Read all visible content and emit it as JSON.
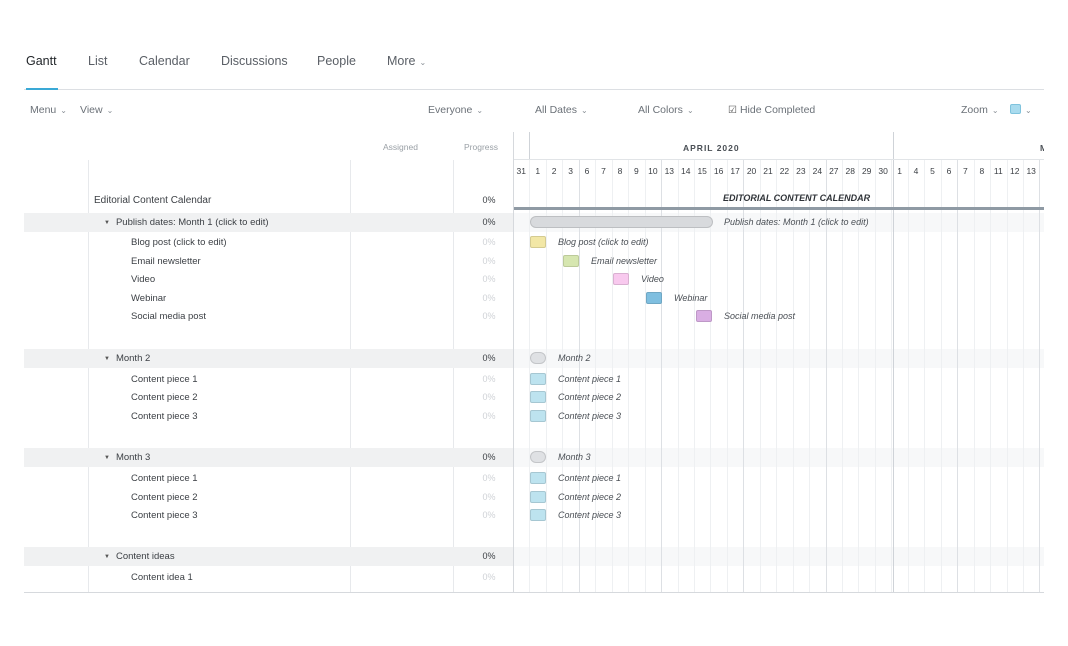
{
  "tabs": [
    {
      "label": "Gantt"
    },
    {
      "label": "List"
    },
    {
      "label": "Calendar"
    },
    {
      "label": "Discussions"
    },
    {
      "label": "People"
    },
    {
      "label": "More"
    }
  ],
  "toolbar": {
    "menu": "Menu",
    "view": "View",
    "everyone": "Everyone",
    "all_dates": "All Dates",
    "all_colors": "All Colors",
    "hide_completed": "Hide Completed",
    "zoom": "Zoom"
  },
  "columns": {
    "assigned": "Assigned",
    "progress": "Progress"
  },
  "timeline": {
    "month1": "APRIL 2020",
    "month2": "M",
    "days": [
      "31",
      "1",
      "2",
      "3",
      "6",
      "7",
      "8",
      "9",
      "10",
      "13",
      "14",
      "15",
      "16",
      "17",
      "20",
      "21",
      "22",
      "23",
      "24",
      "27",
      "28",
      "29",
      "30",
      "1",
      "4",
      "5",
      "6",
      "7",
      "8",
      "11",
      "12",
      "13"
    ]
  },
  "rows": [
    {
      "name": "Editorial Content Calendar",
      "progress": "0%",
      "kind": "title"
    },
    {
      "name": "Publish dates: Month 1 (click to edit)",
      "progress": "0%",
      "kind": "group"
    },
    {
      "name": "Blog post (click to edit)",
      "progress": "0%",
      "kind": "task"
    },
    {
      "name": "Email newsletter",
      "progress": "0%",
      "kind": "task"
    },
    {
      "name": "Video",
      "progress": "0%",
      "kind": "task"
    },
    {
      "name": "Webinar",
      "progress": "0%",
      "kind": "task"
    },
    {
      "name": "Social media post",
      "progress": "0%",
      "kind": "task"
    },
    {
      "name": "Month 2",
      "progress": "0%",
      "kind": "group"
    },
    {
      "name": "Content piece 1",
      "progress": "0%",
      "kind": "task"
    },
    {
      "name": "Content piece 2",
      "progress": "0%",
      "kind": "task"
    },
    {
      "name": "Content piece 3",
      "progress": "0%",
      "kind": "task"
    },
    {
      "name": "Month 3",
      "progress": "0%",
      "kind": "group"
    },
    {
      "name": "Content piece 1",
      "progress": "0%",
      "kind": "task"
    },
    {
      "name": "Content piece 2",
      "progress": "0%",
      "kind": "task"
    },
    {
      "name": "Content piece 3",
      "progress": "0%",
      "kind": "task"
    },
    {
      "name": "Content ideas",
      "progress": "0%",
      "kind": "group"
    },
    {
      "name": "Content idea 1",
      "progress": "0%",
      "kind": "task"
    }
  ],
  "gantt": {
    "title_label": "EDITORIAL CONTENT CALENDAR",
    "items": [
      {
        "label": "Publish dates: Month 1 (click to edit)",
        "color": "#d8dadd"
      },
      {
        "label": "Blog post (click to edit)",
        "color": "#f2e7a6"
      },
      {
        "label": "Email newsletter",
        "color": "#d6e6b0"
      },
      {
        "label": "Video",
        "color": "#f8c9ee"
      },
      {
        "label": "Webinar",
        "color": "#7fbfe0"
      },
      {
        "label": "Social media post",
        "color": "#d9aee3"
      },
      {
        "label": "Month 2",
        "color": "#dfe1e4"
      },
      {
        "label": "Content piece 1",
        "color": "#bde3ef"
      },
      {
        "label": "Content piece 2",
        "color": "#bde3ef"
      },
      {
        "label": "Content piece 3",
        "color": "#bde3ef"
      },
      {
        "label": "Month 3",
        "color": "#dfe1e4"
      },
      {
        "label": "Content piece 1",
        "color": "#bde3ef"
      },
      {
        "label": "Content piece 2",
        "color": "#bde3ef"
      },
      {
        "label": "Content piece 3",
        "color": "#bde3ef"
      }
    ]
  }
}
